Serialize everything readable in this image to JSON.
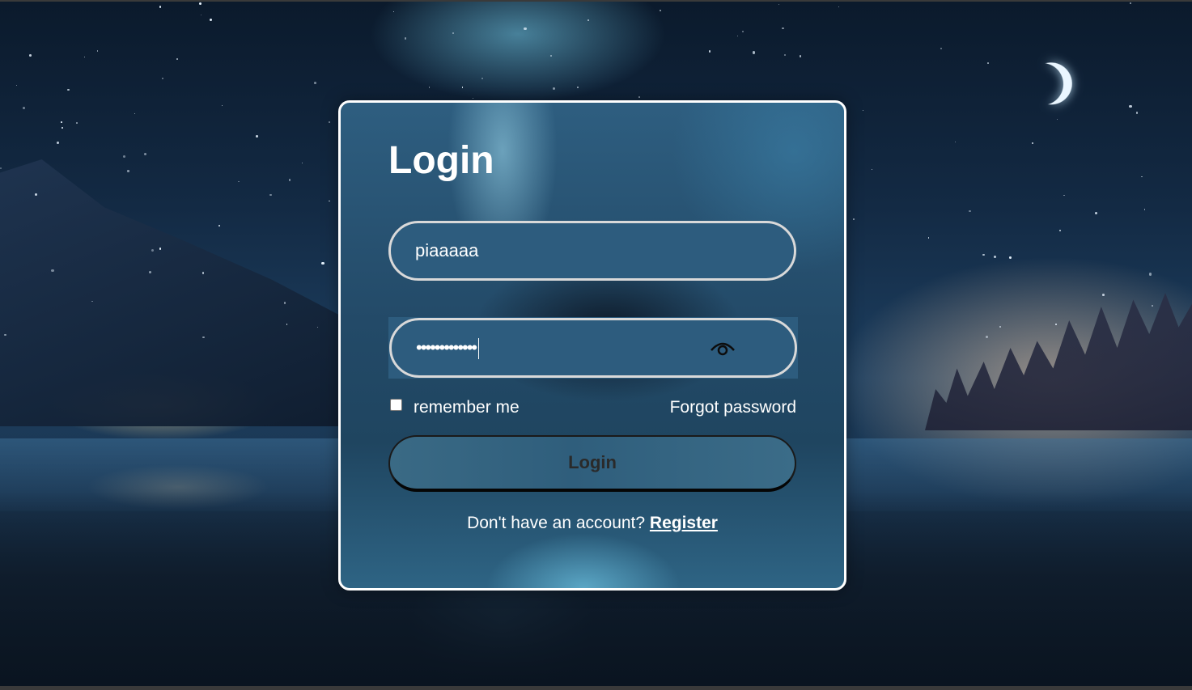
{
  "login_form": {
    "title": "Login",
    "username_value": "piaaaaa",
    "password_mask": "•••••••••••••",
    "remember_label": "remember me",
    "remember_checked": false,
    "forgot_label": "Forgot password",
    "submit_label": "Login",
    "register_prompt": "Don't have an account?",
    "register_label": "Register"
  },
  "icons": {
    "password_toggle": "eye-icon"
  },
  "colors": {
    "card_border": "#ffffff",
    "input_border": "#d9d9d9",
    "input_fill": "#2d5c7e",
    "text": "#ffffff",
    "button_text": "#2a2a2a"
  }
}
